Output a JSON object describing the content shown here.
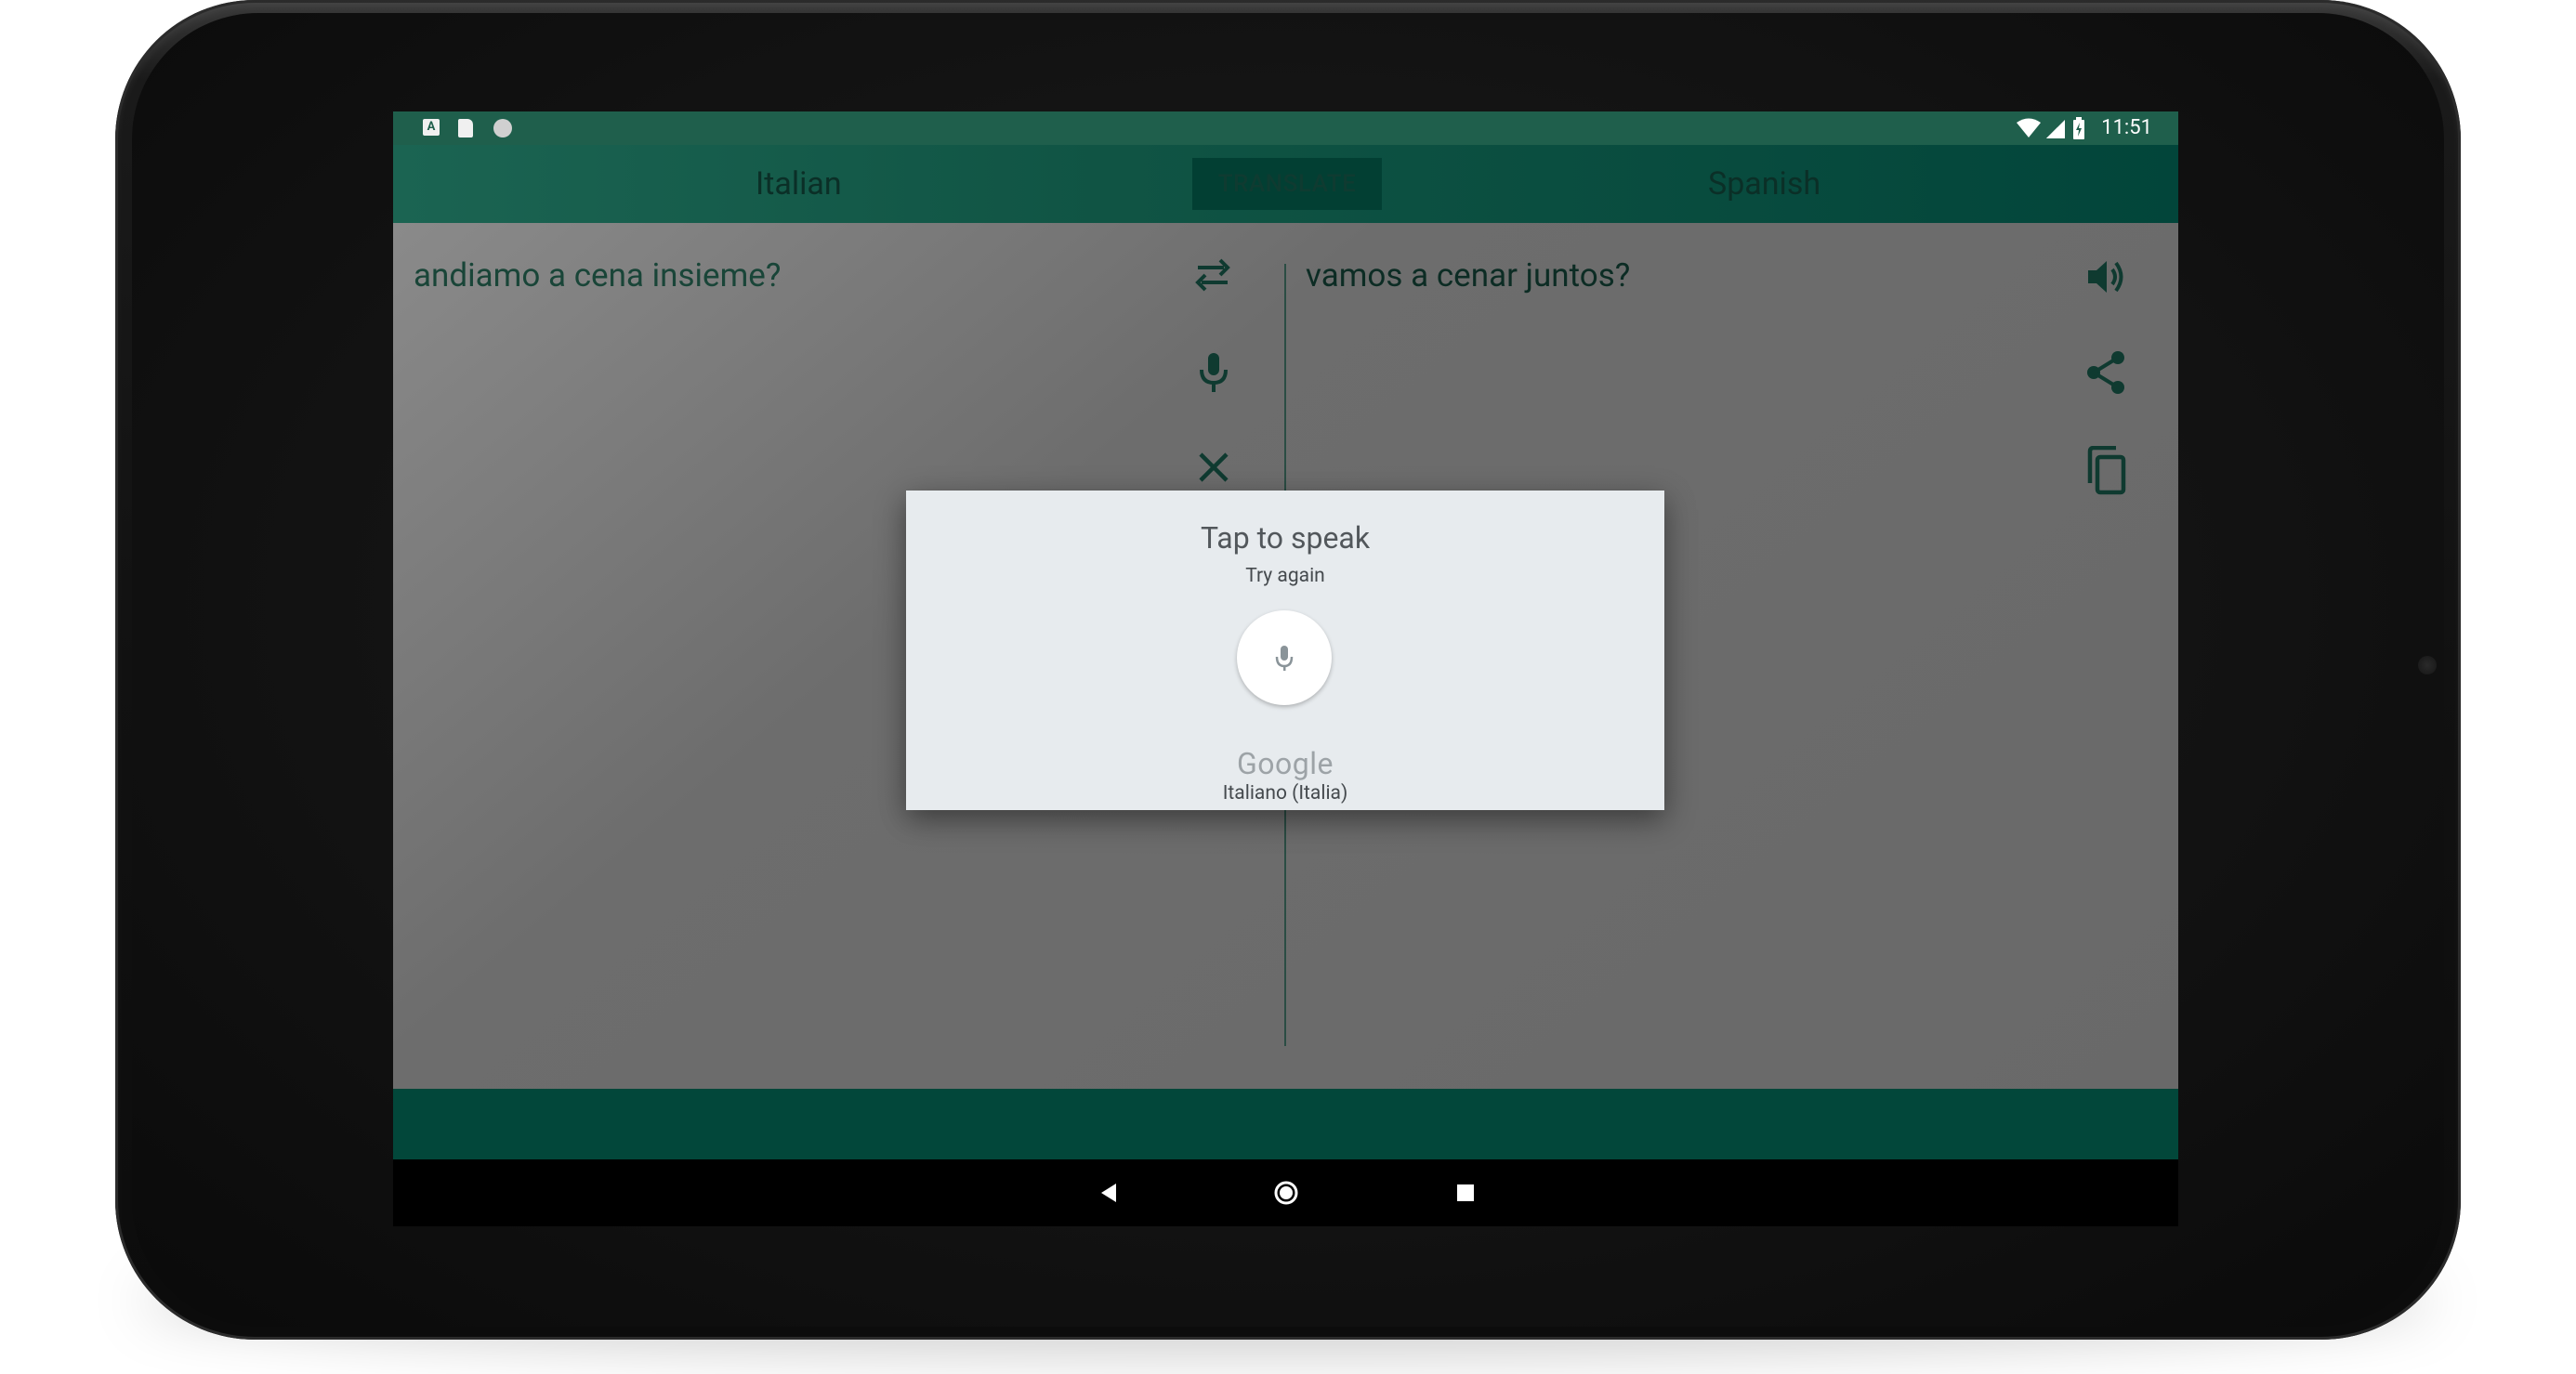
{
  "status_bar": {
    "time": "11:51",
    "notification_icons": [
      "text-a-icon",
      "sd-card-icon",
      "circle-icon"
    ],
    "system_icons": [
      "wifi-icon",
      "signal-icon",
      "battery-icon"
    ]
  },
  "app_bar": {
    "source_language": "Italian",
    "translate_label": "TRANSLATE",
    "target_language": "Spanish"
  },
  "source_panel": {
    "text": "andiamo a cena insieme?",
    "actions": [
      "swap-languages-icon",
      "microphone-icon",
      "clear-icon"
    ]
  },
  "target_panel": {
    "text": "vamos a cenar juntos?",
    "actions": [
      "speaker-icon",
      "share-icon",
      "copy-icon"
    ]
  },
  "speech_dialog": {
    "title": "Tap to speak",
    "subtitle": "Try again",
    "brand": "Google",
    "language": "Italiano (Italia)"
  },
  "nav_bar": {
    "buttons": [
      "back-icon",
      "home-icon",
      "recents-icon"
    ]
  },
  "colors": {
    "primary": "#02473a",
    "primary_light": "#1f5f4c",
    "scrim": "#6b6b6b",
    "dialog_bg": "#e7ebee"
  }
}
